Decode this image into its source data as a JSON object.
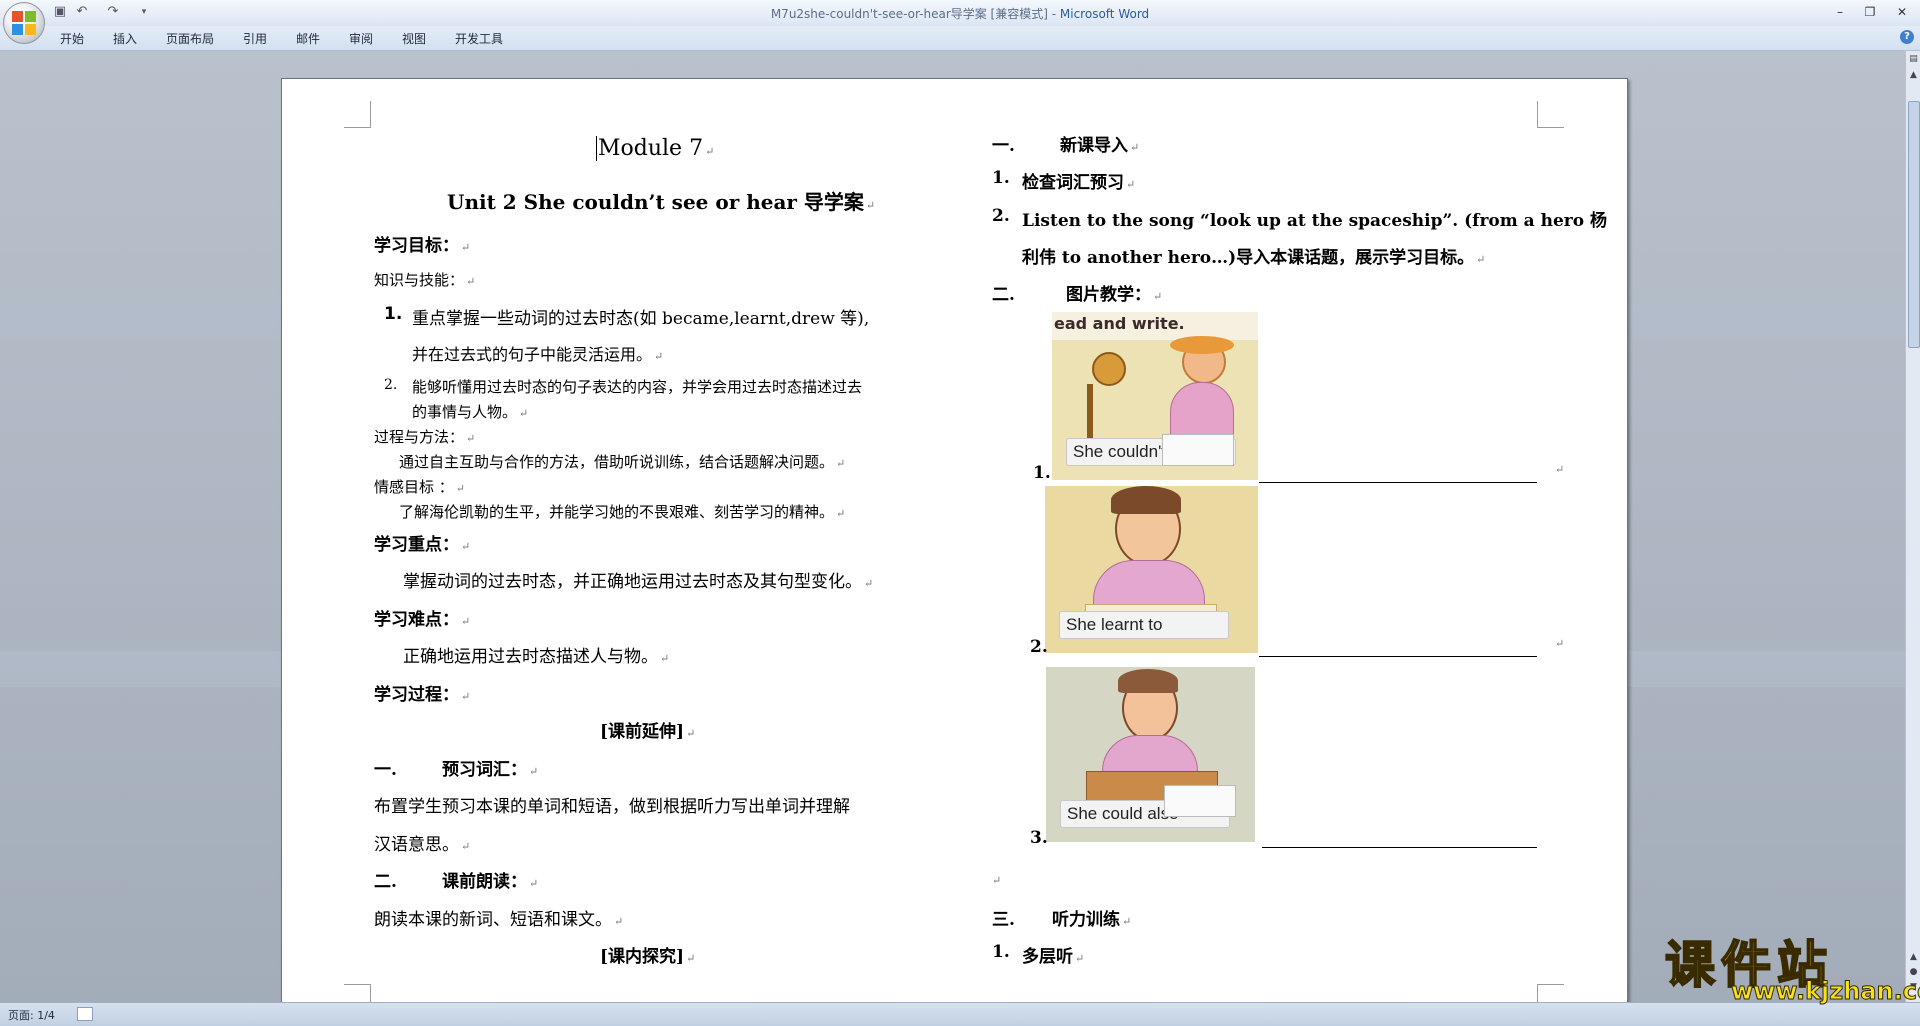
{
  "window": {
    "title": "M7u2she-couldn't-see-or-hear导学案 [兼容模式] - ",
    "app_name": "Microsoft Word"
  },
  "ribbon": {
    "tabs": [
      "开始",
      "插入",
      "页面布局",
      "引用",
      "邮件",
      "审阅",
      "视图",
      "开发工具"
    ]
  },
  "document": {
    "left": {
      "title1": "Module 7",
      "title2": "Unit 2 She couldn’t see or hear 导学案",
      "goal_heading": "学习目标：",
      "knowledge_heading": "知识与技能：",
      "item1_num": "1.",
      "item1_line1": "重点掌握一些动词的过去时态(如 became,learnt,drew 等),",
      "item1_line2": "并在过去式的句子中能灵活运用。",
      "item2_num": "2.",
      "item2_line1": "能够听懂用过去时态的句子表达的内容，并学会用过去时态描述过去",
      "item2_line2": "的事情与人物。",
      "process_heading": "过程与方法：",
      "process_text": "通过自主互助与合作的方法，借助听说训练，结合话题解决问题。",
      "emotion_heading": "情感目标 ：",
      "emotion_text": "了解海伦凯勒的生平，并能学习她的不畏艰难、刻苦学习的精神。",
      "key_heading": "学习重点：",
      "key_text": "掌握动词的过去时态，并正确地运用过去时态及其句型变化。",
      "diff_heading": "学习难点：",
      "diff_text": "正确地运用过去时态描述人与物。",
      "process2_heading": "学习过程：",
      "pre_heading": "[课前延伸]",
      "vocab_num": "一.",
      "vocab_heading": "预习词汇：",
      "vocab_line1": "布置学生预习本课的单词和短语，做到根据听力写出单词并理解",
      "vocab_line2": "汉语意思。",
      "read_num": "二.",
      "read_heading": "课前朗读：",
      "read_text": "朗读本课的新词、短语和课文。",
      "class_heading": "[课内探究]"
    },
    "right": {
      "intro_num": "一.",
      "intro_heading": "新课导入",
      "r1_num": "1.",
      "r1_text": "检查词汇预习",
      "r2_num": "2.",
      "r2_line1": "Listen to the song “look up at the spaceship”. (from a hero 杨",
      "r2_line2": "利伟 to another hero…)导入本课话题，展示学习目标。",
      "pic_num": "二.",
      "pic_heading": "图片教学：",
      "pic1_num": "1.",
      "pic1_header": "ead and write.",
      "pic1_caption": "She couldn't",
      "pic2_num": "2.",
      "pic2_caption": "She learnt to",
      "pic3_num": "3.",
      "pic3_caption": "She could also",
      "listen_num": "三.",
      "listen_heading": "听力训练",
      "l1_num": "1.",
      "l1_text": "多层听"
    }
  },
  "statusbar": {
    "page_label": "页面: 1/4"
  },
  "watermark": {
    "brand": "课件站",
    "url": "www.kjzhan.com"
  }
}
